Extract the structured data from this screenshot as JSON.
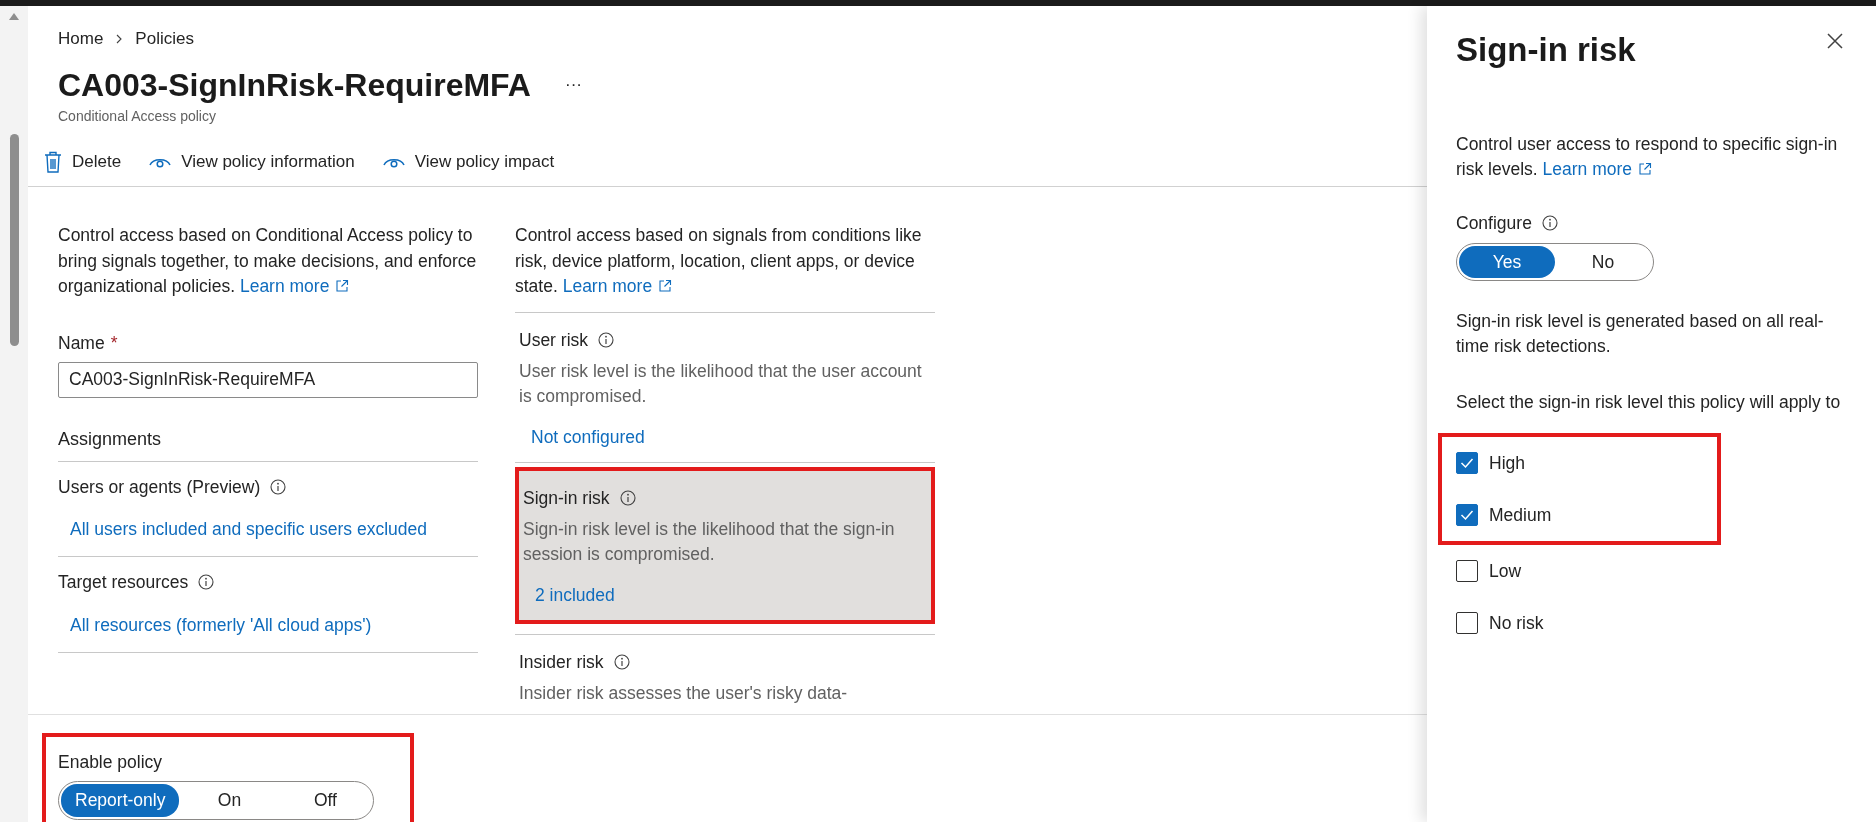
{
  "breadcrumb": [
    {
      "label": "Home"
    },
    {
      "label": "Policies"
    }
  ],
  "page": {
    "title": "CA003-SignInRisk-RequireMFA",
    "more": "···",
    "subtitle": "Conditional Access policy"
  },
  "toolbar": [
    {
      "kind": "delete",
      "label": "Delete"
    },
    {
      "kind": "view",
      "label": "View policy information"
    },
    {
      "kind": "view",
      "label": "View policy impact"
    }
  ],
  "assignments_column": {
    "description": "Control access based on Conditional Access policy to bring signals together, to make decisions, and enforce organizational policies.",
    "learn_more": "Learn more",
    "name_field": {
      "label": "Name",
      "required_mark": "*",
      "value": "CA003-SignInRisk-RequireMFA"
    },
    "heading": "Assignments",
    "items": [
      {
        "label": "Users or agents (Preview)",
        "link": "All users included and specific users excluded"
      },
      {
        "label": "Target resources",
        "link": "All resources (formerly 'All cloud apps')"
      }
    ]
  },
  "conditions_column": {
    "description": "Control access based on signals from conditions like risk, device platform, location, client apps, or device state.",
    "learn_more": "Learn more",
    "items": [
      {
        "label": "User risk",
        "description": "User risk level is the likelihood that the user account is compromised.",
        "link": "Not configured",
        "selected": false,
        "highlighted": false
      },
      {
        "label": "Sign-in risk",
        "description": "Sign-in risk level is the likelihood that the sign-in session is compromised.",
        "link": "2 included",
        "selected": true,
        "highlighted": true
      },
      {
        "label": "Insider risk",
        "description": "Insider risk assesses the user's risky data-",
        "selected": false,
        "highlighted": false
      }
    ]
  },
  "enable_policy": {
    "label": "Enable policy",
    "highlighted": true,
    "options": [
      {
        "label": "Report-only",
        "selected": true
      },
      {
        "label": "On",
        "selected": false
      },
      {
        "label": "Off",
        "selected": false
      }
    ]
  },
  "panel": {
    "title": "Sign-in risk",
    "description": "Control user access to respond to specific sign-in risk levels.",
    "learn_more": "Learn more",
    "configure": {
      "label": "Configure",
      "options": [
        {
          "label": "Yes",
          "selected": true
        },
        {
          "label": "No",
          "selected": false
        }
      ]
    },
    "note": "Sign-in risk level is generated based on all real-time risk detections.",
    "prompt": "Select the sign-in risk level this policy will apply to",
    "levels": [
      {
        "label": "High",
        "checked": true,
        "highlighted": true
      },
      {
        "label": "Medium",
        "checked": true,
        "highlighted": true
      },
      {
        "label": "Low",
        "checked": false,
        "highlighted": false
      },
      {
        "label": "No risk",
        "checked": false,
        "highlighted": false
      }
    ]
  }
}
